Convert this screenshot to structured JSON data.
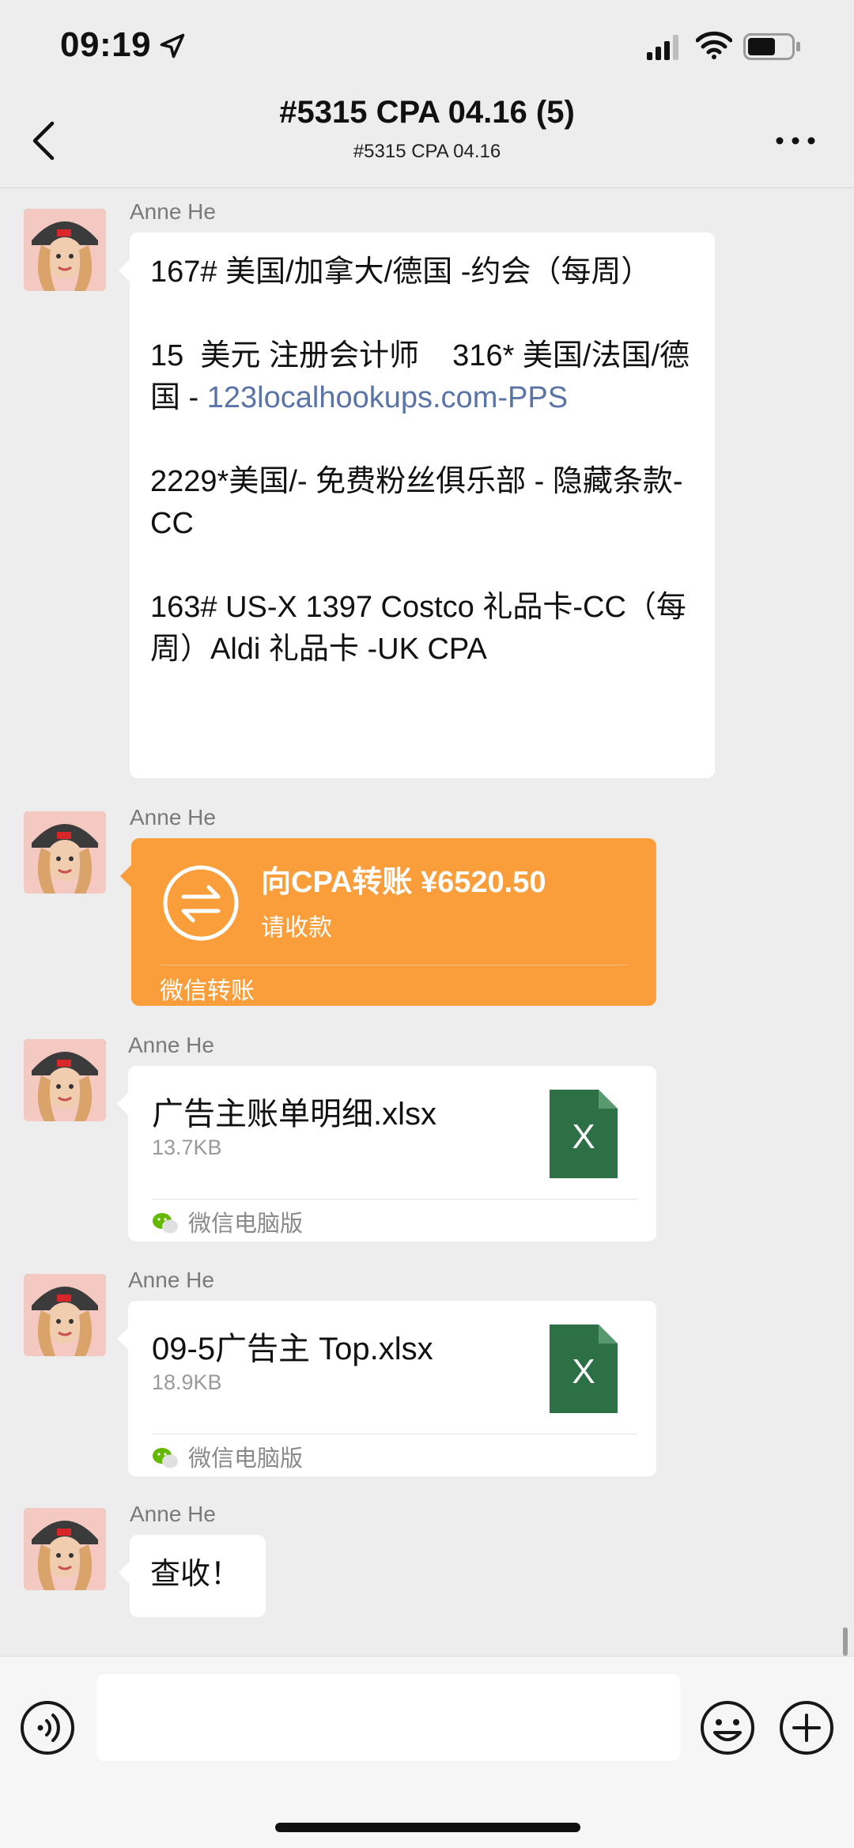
{
  "status_bar": {
    "time": "09:19"
  },
  "nav": {
    "title": "#5315 CPA 04.16 (5)",
    "subtitle": "#5315 CPA 04.16"
  },
  "messages": [
    {
      "type": "text",
      "sender": "Anne He",
      "segments": [
        "167# 美国/加拿大/德国 -约会（每周）\n\n15  美元 注册会计师    316* 美国/法国/德国 - ",
        "123localhookups.com-PPS",
        "\n\n2229*美国/- 免费粉丝俱乐部 - 隐藏条款-CC\n\n163# US-X 1397 Costco 礼品卡-CC（每周）Aldi 礼品卡 -UK CPA"
      ]
    },
    {
      "type": "transfer",
      "sender": "Anne He",
      "title": "向CPA转账 ¥6520.50",
      "subtitle": "请收款",
      "footer": "微信转账"
    },
    {
      "type": "file",
      "sender": "Anne He",
      "file_name": "广告主账单明细.xlsx",
      "file_size": "13.7KB",
      "icon_letter": "X",
      "source": "微信电脑版"
    },
    {
      "type": "file",
      "sender": "Anne He",
      "file_name": "09-5广告主 Top.xlsx",
      "file_size": "18.9KB",
      "icon_letter": "X",
      "source": "微信电脑版"
    },
    {
      "type": "text_short",
      "sender": "Anne He",
      "text": "查收！"
    }
  ],
  "colors": {
    "background": "#ededed",
    "transfer": "#f99e3b",
    "excel_green": "#2e7045",
    "link": "#5b74a8"
  }
}
